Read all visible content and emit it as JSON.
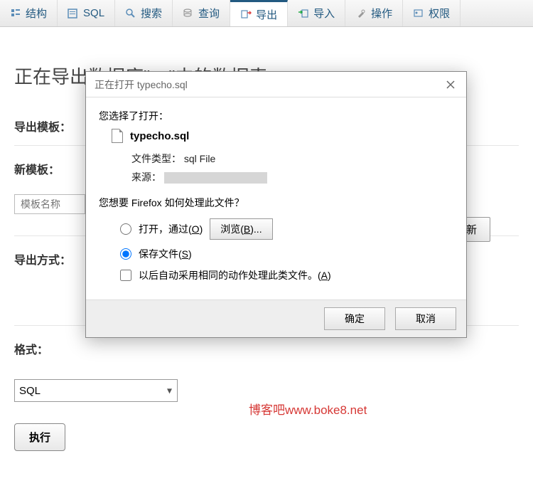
{
  "tabs": [
    {
      "icon": "structure-icon",
      "label": "结构"
    },
    {
      "icon": "sql-icon",
      "label": "SQL"
    },
    {
      "icon": "search-icon",
      "label": "搜索"
    },
    {
      "icon": "query-icon",
      "label": "查询"
    },
    {
      "icon": "export-icon",
      "label": "导出",
      "active": true
    },
    {
      "icon": "import-icon",
      "label": "导入"
    },
    {
      "icon": "operations-icon",
      "label": "操作"
    },
    {
      "icon": "privileges-icon",
      "label": "权限"
    }
  ],
  "page": {
    "title": "正在导出数据库\"…\"中的数据表",
    "export_template_label": "导出模板：",
    "new_template_label": "新模板：",
    "template_placeholder": "模板名称",
    "update_btn": "更新",
    "export_method_label": "导出方式：",
    "format_label": "格式：",
    "format_value": "SQL",
    "exec_btn": "执行"
  },
  "watermark": "博客吧www.boke8.net",
  "dialog": {
    "title": "正在打开 typecho.sql",
    "chose_open": "您选择了打开：",
    "filename": "typecho.sql",
    "filetype_label": "文件类型：",
    "filetype_value": "sql File",
    "source_label": "来源：",
    "prompt": "您想要 Firefox 如何处理此文件？",
    "open_label_prefix": "打开，通过(",
    "open_label_key": "O",
    "open_label_suffix": ")",
    "browse_prefix": "浏览(",
    "browse_key": "B",
    "browse_suffix": ")...",
    "save_prefix": "保存文件(",
    "save_key": "S",
    "save_suffix": ")",
    "remember_prefix": "以后自动采用相同的动作处理此类文件。(",
    "remember_key": "A",
    "remember_suffix": ")",
    "ok": "确定",
    "cancel": "取消"
  }
}
